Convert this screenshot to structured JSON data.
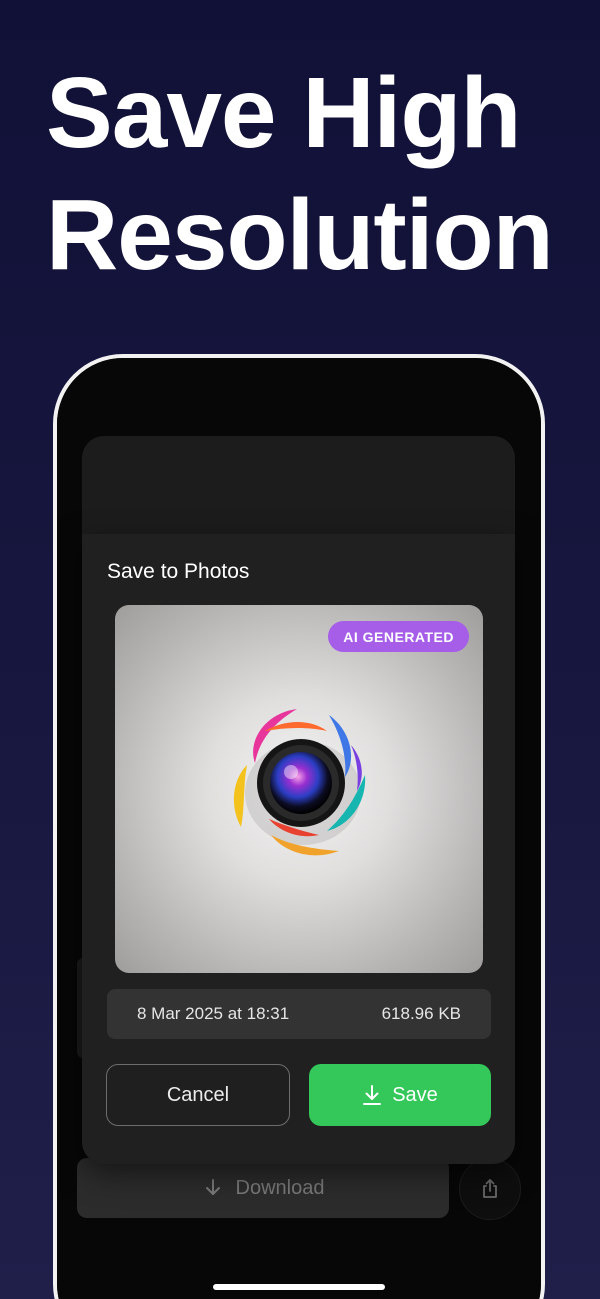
{
  "headline": {
    "line1": "Save High",
    "line2": "Resolution"
  },
  "background_app": {
    "download_label": "Download",
    "download_icon": "download-arrow-icon",
    "share_icon": "share-icon"
  },
  "sheet": {
    "title": "Save to Photos",
    "badge": "AI GENERATED",
    "image": "colorful-camera-lens-logo",
    "date": "8 Mar 2025 at 18:31",
    "size": "618.96 KB",
    "cancel_label": "Cancel",
    "save_label": "Save",
    "save_icon": "download-arrow-icon"
  },
  "colors": {
    "background": "#15153c",
    "save_button": "#34c759",
    "badge": "#a65ee9",
    "sheet": "#202020"
  }
}
